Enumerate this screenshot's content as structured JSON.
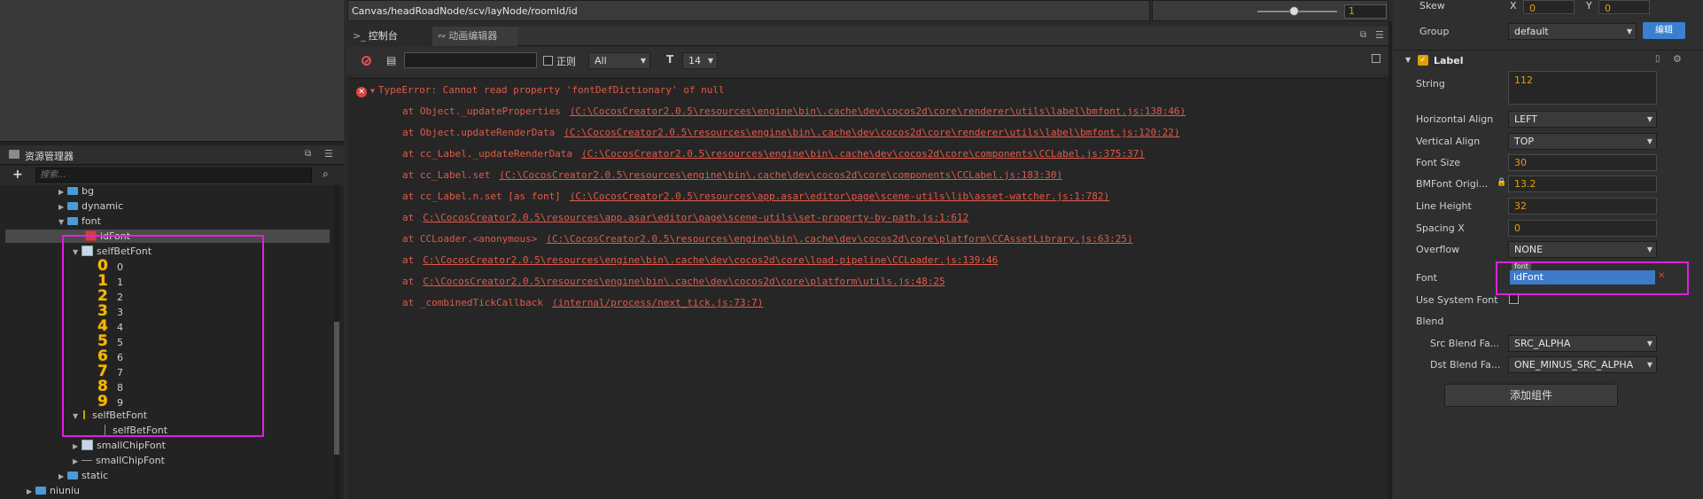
{
  "assets_panel": {
    "title": "资源管理器",
    "search_placeholder": "搜索...",
    "tree": {
      "bg": "bg",
      "dynamic": "dynamic",
      "font": "font",
      "idFont": "idFont",
      "selfBetFont_1": "selfBetFont",
      "glyphs": [
        "0",
        "1",
        "2",
        "3",
        "4",
        "5",
        "6",
        "7",
        "8",
        "9"
      ],
      "glyph_names": [
        "0",
        "1",
        "2",
        "3",
        "4",
        "5",
        "6",
        "7",
        "8",
        "9"
      ],
      "selfBetFont_2": "selfBetFont",
      "selfBetFont_3": "selfBetFont",
      "smallChipFont_1": "smallChipFont",
      "smallChipFont_2": "smallChipFont",
      "static": "static",
      "niuniu": "niuniu"
    }
  },
  "scene": {
    "path": "Canvas/headRoadNode/scv/layNode/roomId/id",
    "zoom": "1"
  },
  "console": {
    "tab_console": "控制台",
    "tab_animation": "动画编辑器",
    "regex_label": "正则",
    "level": "All",
    "font_size": "14",
    "error_title": "TypeError: Cannot read property 'fontDefDictionary' of null",
    "stack": [
      {
        "at": "at Object._updateProperties",
        "src": "(C:\\CocosCreator2.0.5\\resources\\engine\\bin\\.cache\\dev\\cocos2d\\core\\renderer\\utils\\label\\bmfont.js:138:46)"
      },
      {
        "at": "at Object.updateRenderData",
        "src": "(C:\\CocosCreator2.0.5\\resources\\engine\\bin\\.cache\\dev\\cocos2d\\core\\renderer\\utils\\label\\bmfont.js:120:22)"
      },
      {
        "at": "at cc_Label._updateRenderData",
        "src": "(C:\\CocosCreator2.0.5\\resources\\engine\\bin\\.cache\\dev\\cocos2d\\core\\components\\CCLabel.js:375:37)"
      },
      {
        "at": "at cc_Label.set",
        "src": "(C:\\CocosCreator2.0.5\\resources\\engine\\bin\\.cache\\dev\\cocos2d\\core\\components\\CCLabel.js:183:30)"
      },
      {
        "at": "at cc_Label.n.set [as font]",
        "src": "(C:\\CocosCreator2.0.5\\resources\\app.asar\\editor\\page\\scene-utils\\lib\\asset-watcher.js:1:782)"
      },
      {
        "at": "at",
        "src": "C:\\CocosCreator2.0.5\\resources\\app.asar\\editor\\page\\scene-utils\\set-property-by-path.js:1:612"
      },
      {
        "at": "at CCLoader.<anonymous>",
        "src": "(C:\\CocosCreator2.0.5\\resources\\engine\\bin\\.cache\\dev\\cocos2d\\core\\platform\\CCAssetLibrary.js:63:25)"
      },
      {
        "at": "at",
        "src": "C:\\CocosCreator2.0.5\\resources\\engine\\bin\\.cache\\dev\\cocos2d\\core\\load-pipeline\\CCLoader.js:139:46"
      },
      {
        "at": "at",
        "src": "C:\\CocosCreator2.0.5\\resources\\engine\\bin\\.cache\\dev\\cocos2d\\core\\platform\\utils.js:48:25"
      },
      {
        "at": "at _combinedTickCallback",
        "src": "(internal/process/next_tick.js:73:7)"
      }
    ]
  },
  "inspector": {
    "skew_label": "Skew",
    "skew_x_label": "X",
    "skew_x": "0",
    "skew_y_label": "Y",
    "skew_y": "0",
    "group_label": "Group",
    "group_value": "default",
    "edit_button": "编辑",
    "component": "Label",
    "string_label": "String",
    "string_value": "112",
    "halign_label": "Horizontal Align",
    "halign_value": "LEFT",
    "valign_label": "Vertical Align",
    "valign_value": "TOP",
    "fontsize_label": "Font Size",
    "fontsize_value": "30",
    "bmfont_label": "BMFont Origi...",
    "bmfont_value": "13.2",
    "lineheight_label": "Line Height",
    "lineheight_value": "32",
    "spacing_label": "Spacing X",
    "spacing_value": "0",
    "overflow_label": "Overflow",
    "overflow_value": "NONE",
    "font_label": "Font",
    "font_tag": "font",
    "font_value": "idFont",
    "system_font_label": "Use System Font",
    "blend_label": "Blend",
    "src_blend_label": "Src Blend Fa...",
    "src_blend_value": "SRC_ALPHA",
    "dst_blend_label": "Dst Blend Fa...",
    "dst_blend_value": "ONE_MINUS_SRC_ALPHA",
    "add_component": "添加组件"
  },
  "colors": {
    "error": "#e25a4a",
    "highlight": "#e020e0",
    "value": "#e0a000",
    "accent": "#3a7fd0"
  }
}
